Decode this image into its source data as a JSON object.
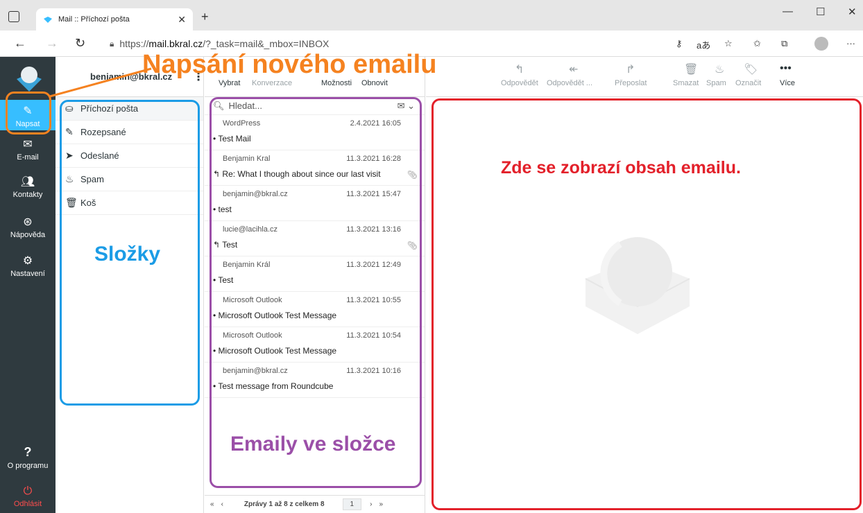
{
  "browser": {
    "tab_title": "Mail :: Příchozí pošta",
    "url_prefix": "https://",
    "url_host": "mail.bkral.cz",
    "url_path": "/?_task=mail&_mbox=INBOX"
  },
  "nav": {
    "compose": "Napsat",
    "mail": "E-mail",
    "contacts": "Kontakty",
    "help": "Nápověda",
    "settings": "Nastavení",
    "about": "O programu",
    "logout": "Odhlásit"
  },
  "account": "benjamin@bkral.cz",
  "folders": [
    {
      "name": "Příchozí pošta",
      "icon": "inbox-icon"
    },
    {
      "name": "Rozepsané",
      "icon": "pencil-icon"
    },
    {
      "name": "Odeslané",
      "icon": "paper-plane-icon"
    },
    {
      "name": "Spam",
      "icon": "fire-icon"
    },
    {
      "name": "Koš",
      "icon": "trash-icon"
    }
  ],
  "list_toolbar": {
    "select": "Vybrat",
    "threads": "Konverzace",
    "options": "Možnosti",
    "refresh": "Obnovit"
  },
  "search_placeholder": "Hledat...",
  "messages": [
    {
      "from": "WordPress",
      "date": "2.4.2021 16:05",
      "subject": "Test Mail",
      "marker": "•",
      "attachment": false
    },
    {
      "from": "Benjamin Kral",
      "date": "11.3.2021 16:28",
      "subject": "Re: What I though about since our last visit",
      "marker": "↰",
      "attachment": true
    },
    {
      "from": "benjamin@bkral.cz",
      "date": "11.3.2021 15:47",
      "subject": "test",
      "marker": "•",
      "attachment": false
    },
    {
      "from": "lucie@lacihla.cz",
      "date": "11.3.2021 13:16",
      "subject": "Test",
      "marker": "↰",
      "attachment": true
    },
    {
      "from": "Benjamin Král",
      "date": "11.3.2021 12:49",
      "subject": "Test",
      "marker": "•",
      "attachment": false
    },
    {
      "from": "Microsoft Outlook",
      "date": "11.3.2021 10:55",
      "subject": "Microsoft Outlook Test Message",
      "marker": "•",
      "attachment": false
    },
    {
      "from": "Microsoft Outlook",
      "date": "11.3.2021 10:54",
      "subject": "Microsoft Outlook Test Message",
      "marker": "•",
      "attachment": false
    },
    {
      "from": "benjamin@bkral.cz",
      "date": "11.3.2021 10:16",
      "subject": "Test message from Roundcube",
      "marker": "•",
      "attachment": false
    }
  ],
  "pager": {
    "text": "Zprávy 1 až 8 z celkem 8",
    "page": "1"
  },
  "message_toolbar": {
    "reply": "Odpovědět",
    "reply_all": "Odpovědět ...",
    "forward": "Přeposlat",
    "delete": "Smazat",
    "spam": "Spam",
    "mark": "Označit",
    "more": "Více"
  },
  "annotations": {
    "compose": "Napsání nového emailu",
    "folders": "Složky",
    "emails": "Emaily ve složce",
    "content": "Zde se zobrazí obsah emailu."
  },
  "colors": {
    "orange": "#f58220",
    "blue": "#1b9ce6",
    "purple": "#9b4fa8",
    "red": "#e3202a",
    "accent": "#37beff"
  }
}
